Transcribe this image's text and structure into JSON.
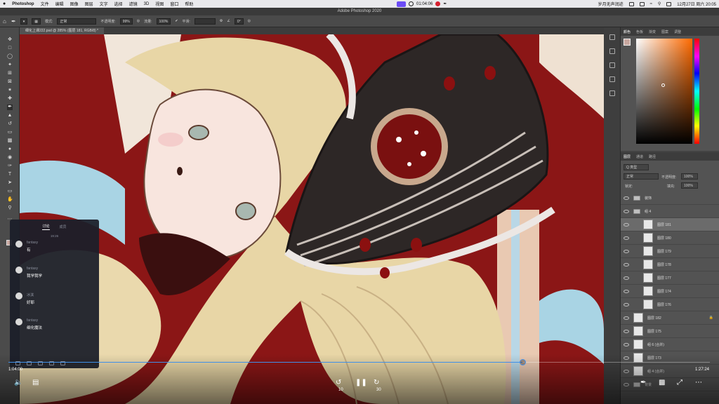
{
  "menubar": {
    "app_name": "Photoshop",
    "items": [
      "文件",
      "编辑",
      "图像",
      "图层",
      "文字",
      "选择",
      "滤镜",
      "3D",
      "视图",
      "窗口",
      "帮助"
    ],
    "recording_time": "01:04:06",
    "status_text": "岁月无声润迹",
    "datetime": "12月27日 周六 20:05"
  },
  "ps": {
    "window_title": "Adobe Photoshop 2020",
    "doc_tab": "细化上课222.psd @ 285% (图层 181, RGB/8) *",
    "options": {
      "mode_label": "模式:",
      "mode_value": "正常",
      "opacity_label": "不透明度:",
      "opacity_value": "99%",
      "flow_label": "流量:",
      "flow_value": "100%",
      "smooth_label": "平滑:",
      "angle_value": "0°"
    }
  },
  "color_panel": {
    "tabs": [
      "颜色",
      "色板",
      "渐变",
      "图案",
      "调整"
    ],
    "fg_color": "#c9a8a0",
    "bg_color": "#ffffff"
  },
  "layers_panel": {
    "tabs": [
      "图层",
      "通道",
      "路径"
    ],
    "filter_value": "Q 类型",
    "blend_mode": "正常",
    "opacity_label": "不透明度:",
    "opacity_value": "100%",
    "lock_label": "锁定:",
    "fill_label": "填充:",
    "fill_value": "100%",
    "layers": [
      {
        "name": "装饰",
        "kind": "group"
      },
      {
        "name": "组 4",
        "kind": "group"
      },
      {
        "name": "图层 181",
        "kind": "layer",
        "selected": true,
        "indent": true
      },
      {
        "name": "图层 180",
        "kind": "layer",
        "indent": true
      },
      {
        "name": "图层 179",
        "kind": "layer",
        "indent": true
      },
      {
        "name": "图层 178",
        "kind": "layer",
        "indent": true
      },
      {
        "name": "图层 177",
        "kind": "layer",
        "indent": true
      },
      {
        "name": "图层 174",
        "kind": "layer",
        "indent": true
      },
      {
        "name": "图层 176",
        "kind": "layer",
        "indent": true
      },
      {
        "name": "图层 182",
        "kind": "layer",
        "locked": true
      },
      {
        "name": "图层 175",
        "kind": "layer"
      },
      {
        "name": "组 6 (合并)",
        "kind": "layer"
      },
      {
        "name": "图层 173",
        "kind": "layer"
      },
      {
        "name": "组 4 (合并)",
        "kind": "layer"
      },
      {
        "name": "背景",
        "kind": "group"
      }
    ]
  },
  "chat": {
    "tab_active": "讨论",
    "tab_other": "成员",
    "time": "19:26",
    "messages": [
      {
        "user": "fantasy",
        "text": "有"
      },
      {
        "user": "fantasy",
        "text": "我学我学"
      },
      {
        "user": "冰淇",
        "text": "好耶"
      },
      {
        "user": "fantasy",
        "text": "细化魔法"
      }
    ]
  },
  "player": {
    "current_time": "1:04:00",
    "total_time": "1:27:24",
    "progress": 0.7323,
    "rewind_label": "10",
    "forward_label": "30"
  },
  "icons": {
    "volume": "volume-icon",
    "subtitles": "subtitles-icon",
    "rewind": "rewind-10-icon",
    "pause": "pause-icon",
    "forward": "forward-30-icon",
    "annotate": "pen-icon",
    "pip": "picture-in-picture-icon",
    "collapse": "collapse-icon",
    "more": "more-icon"
  },
  "colors": {
    "accent": "#3f8fe8",
    "canvas_red": "#8b1616",
    "hair": "#e8d6a6"
  }
}
